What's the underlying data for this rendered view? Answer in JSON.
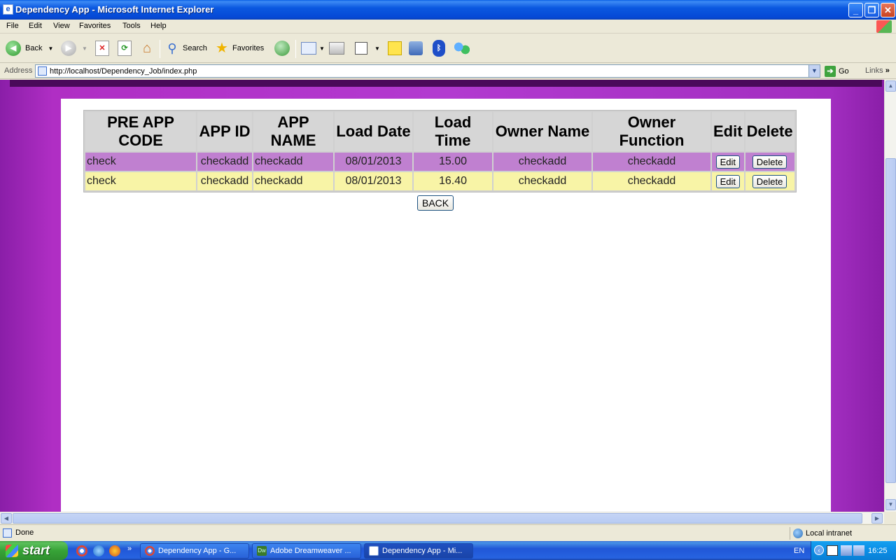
{
  "window": {
    "title": "Dependency App - Microsoft Internet Explorer"
  },
  "menu": [
    "File",
    "Edit",
    "View",
    "Favorites",
    "Tools",
    "Help"
  ],
  "toolbar": {
    "back": "Back",
    "search": "Search",
    "favorites": "Favorites"
  },
  "address": {
    "label": "Address",
    "url": "http://localhost/Dependency_Job/index.php",
    "go": "Go",
    "links": "Links"
  },
  "table": {
    "headers": [
      "PRE APP CODE",
      "APP ID",
      "APP NAME",
      "Load Date",
      "Load Time",
      "Owner Name",
      "Owner Function",
      "Edit",
      "Delete"
    ],
    "rows": [
      {
        "pre_app_code": "check",
        "app_id": "checkadd",
        "app_name": "checkadd",
        "load_date": "08/01/2013",
        "load_time": "15.00",
        "owner_name": "checkadd",
        "owner_function": "checkadd",
        "edit": "Edit",
        "delete": "Delete"
      },
      {
        "pre_app_code": "check",
        "app_id": "checkadd",
        "app_name": "checkadd",
        "load_date": "08/01/2013",
        "load_time": "16.40",
        "owner_name": "checkadd",
        "owner_function": "checkadd",
        "edit": "Edit",
        "delete": "Delete"
      }
    ]
  },
  "back_button": "BACK",
  "status": {
    "text": "Done",
    "zone": "Local intranet"
  },
  "taskbar": {
    "start": "start",
    "tasks": [
      "Dependency App - G...",
      "Adobe Dreamweaver ...",
      "Dependency App - Mi..."
    ],
    "language": "EN",
    "clock": "16:25"
  },
  "colors": {
    "row_purple": "#c080d0",
    "row_yellow": "#f8f4a6",
    "page_bg": "#b23ad0"
  }
}
